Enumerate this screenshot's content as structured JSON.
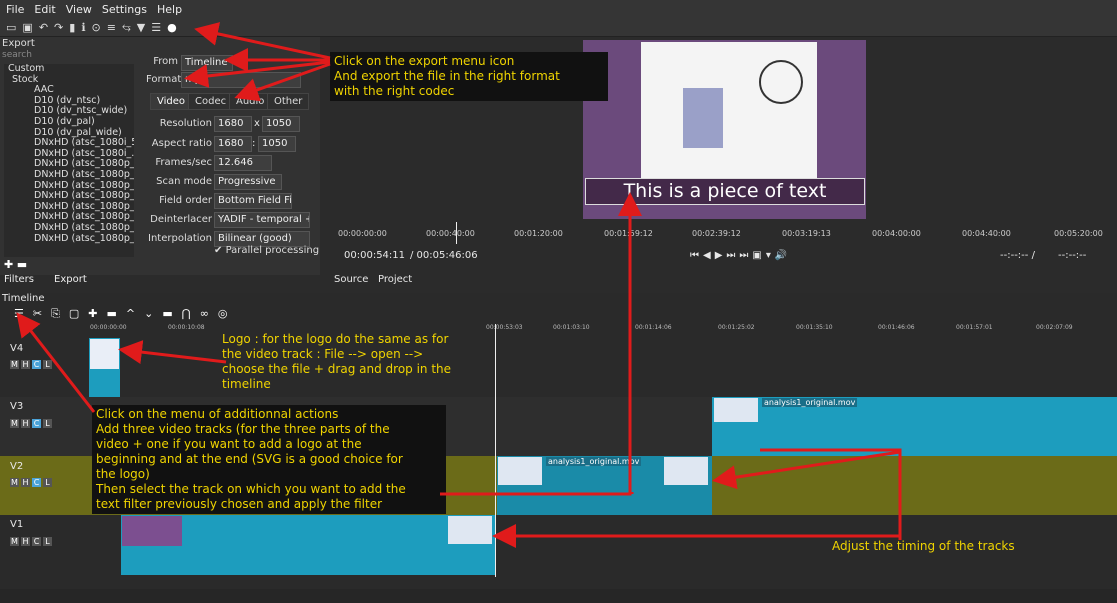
{
  "menubar": {
    "items": [
      "File",
      "Edit",
      "View",
      "Settings",
      "Help"
    ]
  },
  "export": {
    "panel_title": "Export",
    "search_placeholder": "search",
    "list": [
      "Custom",
      "Stock",
      "AAC",
      "D10 (dv_ntsc)",
      "D10 (dv_ntsc_wide)",
      "D10 (dv_pal)",
      "D10 (dv_pal_wide)",
      "DNxHD (atsc_1080i_50)",
      "DNxHD (atsc_1080i_...",
      "DNxHD (atsc_1080p_...",
      "DNxHD (atsc_1080p_...",
      "DNxHD (atsc_1080p_...",
      "DNxHD (atsc_1080p_...",
      "DNxHD (atsc_1080p_...",
      "DNxHD (atsc_1080p_...",
      "DNxHD (atsc_1080p_...",
      "DNxHD (atsc_1080p_..."
    ],
    "from_label": "From",
    "from_value": "Timeline",
    "format_label": "Format",
    "format_value": "mp4",
    "tabs": [
      "Video",
      "Codec",
      "Audio",
      "Other"
    ],
    "resolution_label": "Resolution",
    "res_w": "1680",
    "res_x": "x",
    "res_h": "1050",
    "aspect_label": "Aspect ratio",
    "aspect_w": "1680",
    "aspect_h": "1050",
    "fps_label": "Frames/sec",
    "fps_value": "12.646",
    "scan_label": "Scan mode",
    "scan_value": "Progressive",
    "field_label": "Field order",
    "field_value": "Bottom Field Fi",
    "deint_label": "Deinterlacer",
    "deint_value": "YADIF - temporal +",
    "interp_label": "Interpolation",
    "interp_value": "Bilinear (good)",
    "parallel_label": "Parallel processing",
    "bottom_tabs": [
      "Filters",
      "Export"
    ]
  },
  "viewer": {
    "overlay_text": "This is a piece of text",
    "ruler": [
      "00:00:00:00",
      "00:00:40:00",
      "00:01:20:00",
      "00:01:59:12",
      "00:02:39:12",
      "00:03:19:13",
      "00:04:00:00",
      "00:04:40:00",
      "00:05:20:00"
    ],
    "time_current": "00:00:54:11",
    "time_total": "/ 00:05:46:06",
    "time_in": "--:--:-- /",
    "time_out": "--:--:--",
    "tabs": [
      "Source",
      "Project"
    ]
  },
  "timeline": {
    "title": "Timeline",
    "ruler": [
      "00:00:00:00",
      "00:00:10:08",
      "00:00:53:03",
      "00:01:03:10",
      "00:01:14:06",
      "00:01:25:02",
      "00:01:35:10",
      "00:01:46:06",
      "00:01:57:01",
      "00:02:07:09"
    ],
    "tracks": [
      "V4",
      "V3",
      "V2",
      "V1"
    ],
    "clip_name": "analysis1_original.mov"
  },
  "annotations": {
    "export_note": [
      "Click on the export menu icon",
      "And export the file in the right format",
      "with the right codec"
    ],
    "logo_note": [
      "Logo : for the logo do the same as for",
      "the video track : File --> open -->",
      "choose the file + drag and drop in the",
      "timeline"
    ],
    "tracks_note": [
      "Click on the menu of additionnal actions",
      "Add three video tracks (for the three parts of the",
      "video + one if you want to add a logo at the",
      "beginning and at the end (SVG is a good choice for",
      "the logo)",
      "Then select the track on which you want to add the",
      "text filter previously chosen and apply the filter"
    ],
    "timing_note": [
      "Adjust the timing of the tracks"
    ]
  },
  "colors": {
    "arrow": "#e01b1b",
    "annotation_text": "#f0d400",
    "clip": "#1d9dbe",
    "v2_track": "#6b6b18"
  }
}
